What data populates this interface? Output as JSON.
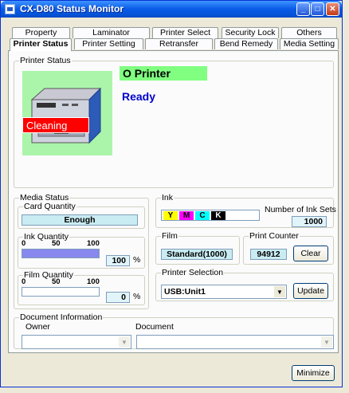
{
  "window": {
    "title": "CX-D80 Status Monitor"
  },
  "tabs_back": [
    "Property",
    "Laminator",
    "Printer Select",
    "Security Lock",
    "Others"
  ],
  "tabs_front": [
    "Printer Status",
    "Printer Setting",
    "Retransfer",
    "Bend Remedy",
    "Media Setting"
  ],
  "active_tab": "Printer Status",
  "printer_status": {
    "group_label": "Printer Status",
    "indicator": "O Printer",
    "state": "Ready",
    "overlay": "Cleaning",
    "colors": {
      "indicator_bg": "#80ff80",
      "image_bg": "#aaf5aa",
      "overlay_bg": "#ff0000",
      "state_text": "#0000cc"
    }
  },
  "media_status": {
    "group_label": "Media Status",
    "card": {
      "label": "Card Quantity",
      "value": "Enough"
    },
    "ink": {
      "label": "Ink Quantity",
      "ticks": [
        "0",
        "50",
        "100"
      ],
      "level_percent": 100,
      "value": "100",
      "unit": "%"
    },
    "film": {
      "label": "Film Quantity",
      "ticks": [
        "0",
        "50",
        "100"
      ],
      "level_percent": 0,
      "value": "0",
      "unit": "%"
    }
  },
  "ink": {
    "group_label": "Ink",
    "swatches": [
      {
        "letter": "Y",
        "color": "#ffff00",
        "text_color": "#000000"
      },
      {
        "letter": "M",
        "color": "#ff00ff",
        "text_color": "#000000"
      },
      {
        "letter": "C",
        "color": "#00ffff",
        "text_color": "#000000"
      },
      {
        "letter": "K",
        "color": "#000000",
        "text_color": "#ffffff"
      }
    ],
    "sets_label": "Number of Ink Sets",
    "sets_value": "1000"
  },
  "film": {
    "group_label": "Film",
    "value": "Standard(1000)"
  },
  "print_counter": {
    "group_label": "Print Counter",
    "value": "94912",
    "clear_label": "Clear"
  },
  "printer_selection": {
    "group_label": "Printer Selection",
    "selected": "USB:Unit1",
    "update_label": "Update"
  },
  "document_info": {
    "group_label": "Document Information",
    "owner_label": "Owner",
    "document_label": "Document",
    "owner_value": "",
    "document_value": ""
  },
  "footer": {
    "minimize_label": "Minimize"
  }
}
